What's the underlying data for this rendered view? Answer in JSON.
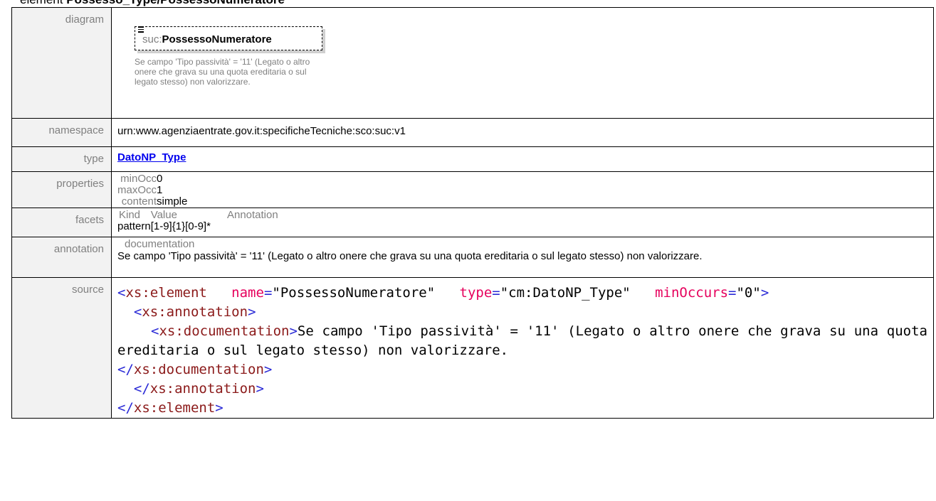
{
  "heading": {
    "prefix": "element ",
    "name": "Possesso_Type/PossessoNumeratore"
  },
  "labels": {
    "diagram": "diagram",
    "namespace": "namespace",
    "type": "type",
    "properties": "properties",
    "facets": "facets",
    "annotation": "annotation",
    "source": "source"
  },
  "diagram": {
    "prefix": "suc:",
    "name": "PossessoNumeratore",
    "note": "Se campo 'Tipo passività' = '11' (Legato o altro onere che grava su una quota ereditaria o sul legato stesso) non valorizzare."
  },
  "namespace": "urn:www.agenziaentrate.gov.it:specificheTecniche:sco:suc:v1",
  "type": "DatoNP_Type",
  "properties": [
    {
      "key": "minOcc",
      "value": "0"
    },
    {
      "key": "maxOcc",
      "value": "1"
    },
    {
      "key": "content",
      "value": "simple"
    }
  ],
  "facets": {
    "headers": [
      "Kind",
      "Value",
      "Annotation"
    ],
    "rows": [
      {
        "kind": "pattern",
        "value": "[1-9]{1}[0-9]*",
        "annotation": ""
      }
    ]
  },
  "annotation": {
    "head": "documentation",
    "text": "Se campo 'Tipo passività' = '11' (Legato o altro onere che grava su una quota ereditaria o sul legato stesso) non valorizzare."
  },
  "source": {
    "element": "xs:element",
    "attr_name": "name",
    "attr_name_value": "\"PossessoNumeratore\"",
    "attr_type": "type",
    "attr_type_value": "\"cm:DatoNP_Type\"",
    "attr_min": "minOccurs",
    "attr_min_value": "\"0\"",
    "annotation_tag": "xs:annotation",
    "documentation_tag": "xs:documentation",
    "documentation_text": "Se campo 'Tipo passività' = '11' (Legato o altro onere che grava su una quota ereditaria o sul legato stesso) non valorizzare."
  },
  "colors": {
    "tag": "#2a2ad6",
    "tag_name": "#8b1a1a",
    "attribute": "#e6005c",
    "link": "#0000ee",
    "label": "#808080"
  }
}
